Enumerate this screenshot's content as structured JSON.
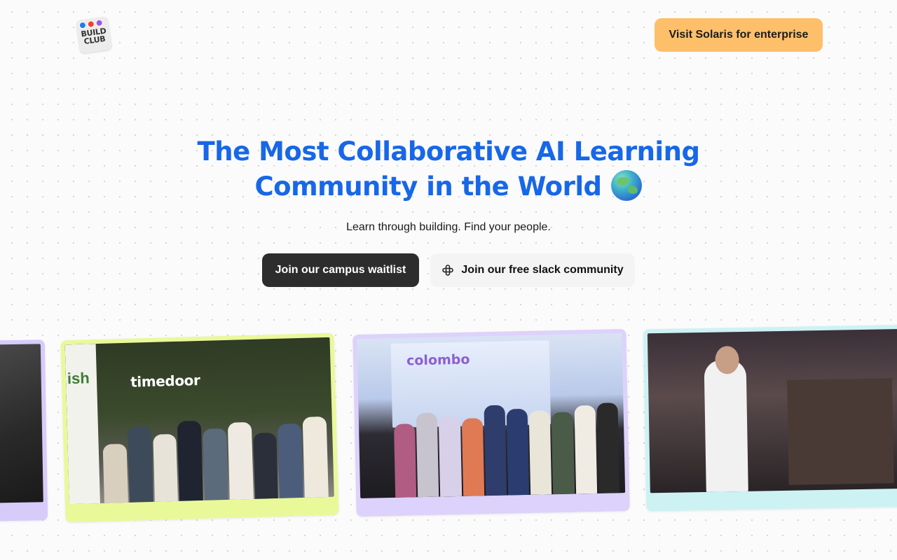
{
  "header": {
    "logo_text": "BUILD CLUB",
    "enterprise_button": "Visit Solaris for enterprise"
  },
  "hero": {
    "title_line1": "The Most Collaborative AI Learning",
    "title_line2": "Community in the World",
    "subtitle": "Learn through building. Find your people.",
    "primary_cta": "Join our campus waitlist",
    "secondary_cta": "Join our free slack community"
  },
  "gallery": {
    "photos": [
      {
        "frame_color": "#d7cbfa"
      },
      {
        "frame_color": "#e9f99a",
        "wall_text": "timedoor",
        "side_text": "ish"
      },
      {
        "frame_color": "#ddd2fb",
        "screen_text": "colombo"
      },
      {
        "frame_color": "#cdf2f4"
      }
    ]
  },
  "colors": {
    "title_blue": "#1767e8",
    "enterprise_orange": "#fdbf6a",
    "dark_button": "#2d2d2d",
    "light_button": "#f4f4f4"
  },
  "icons": {
    "logo": "build-club-logo",
    "globe": "globe-emoji-icon",
    "slack": "slack-icon"
  }
}
